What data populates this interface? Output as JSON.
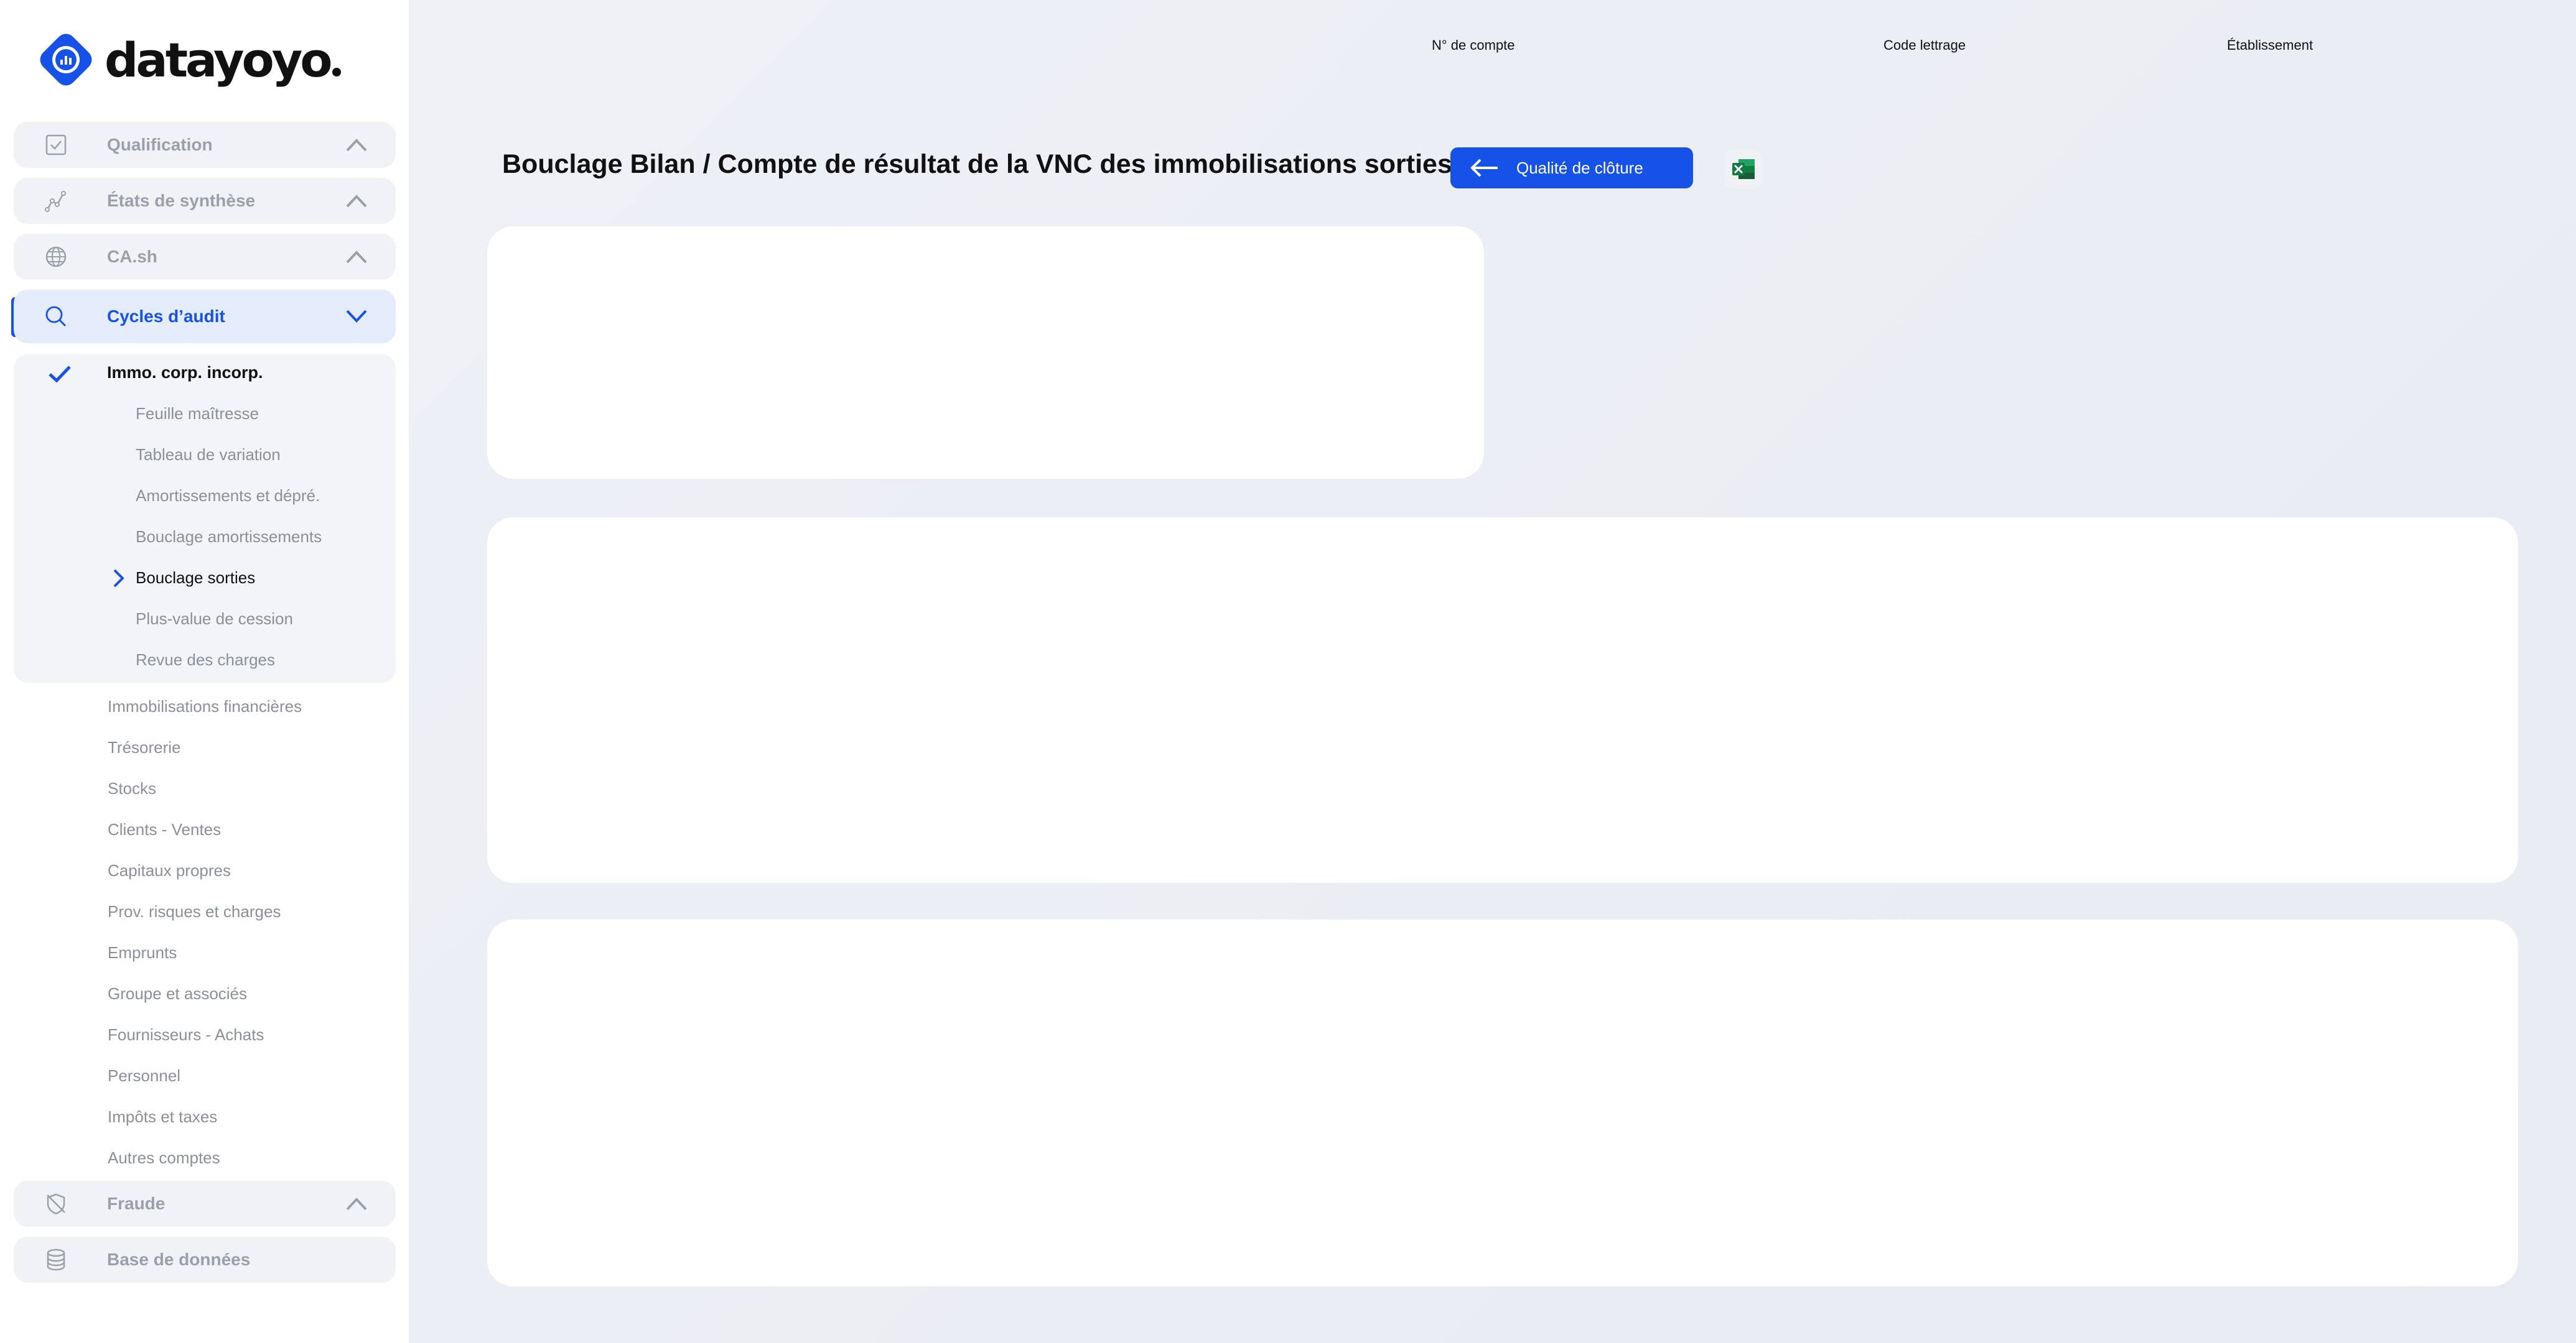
{
  "brand": {
    "name": "datayoyo"
  },
  "sidebar": {
    "sections": [
      {
        "label": "Qualification",
        "icon": "checkbox-icon",
        "expanded": false
      },
      {
        "label": "États de synthèse",
        "icon": "chart-line-icon",
        "expanded": false
      },
      {
        "label": "CA.sh",
        "icon": "globe-icon",
        "expanded": false
      },
      {
        "label": "Cycles d’audit",
        "icon": "search-icon",
        "expanded": true
      },
      {
        "label": "Fraude",
        "icon": "shield-slash-icon",
        "expanded": false
      },
      {
        "label": "Base de données",
        "icon": "database-icon",
        "expanded": false
      }
    ],
    "active_cycle": {
      "label": "Immo. corp. incorp.",
      "items": [
        "Feuille maîtresse",
        "Tableau de variation",
        "Amortissements et dépré.",
        "Bouclage amortissements",
        "Bouclage sorties",
        "Plus-value de cession",
        "Revue des charges"
      ],
      "current": "Bouclage sorties"
    },
    "cycles": [
      "Immobilisations financières",
      "Trésorerie",
      "Stocks",
      "Clients - Ventes",
      "Capitaux propres",
      "Prov. risques et charges",
      "Emprunts",
      "Groupe et associés",
      "Fournisseurs - Achats",
      "Personnel",
      "Impôts et taxes",
      "Autres comptes"
    ]
  },
  "header": {
    "columns": [
      "N° de compte",
      "Code lettrage",
      "Établissement"
    ]
  },
  "main": {
    "title": "Bouclage Bilan / Compte de résultat de la VNC des immobilisations sorties",
    "back_button": "Qualité de clôture",
    "export_icon": "excel-icon"
  },
  "colors": {
    "accent": "#1652e8",
    "excel": "#1d7a45"
  }
}
